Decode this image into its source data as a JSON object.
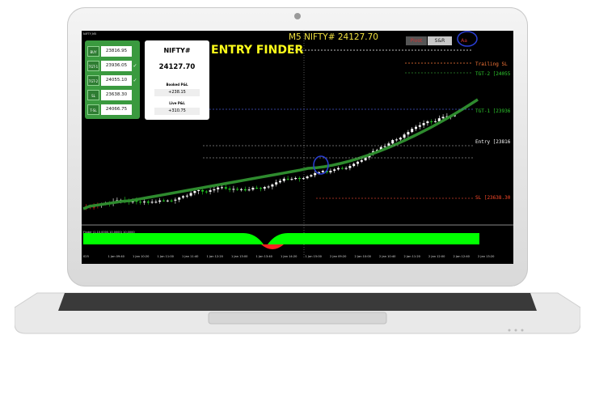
{
  "window": {
    "title": "M5 NIFTY# 24127.70",
    "corner_label": "NIFTY,M5"
  },
  "overlay_title": "ENTRY FINDER",
  "panel": {
    "rows": [
      {
        "key": "BUY",
        "value": "23816.95",
        "check": ""
      },
      {
        "key": "TGT-1",
        "value": "23936.05",
        "check": "✓"
      },
      {
        "key": "TGT-2",
        "value": "24055.10",
        "check": "✓"
      },
      {
        "key": "SL",
        "value": "23638.30",
        "check": ""
      },
      {
        "key": "T-SL",
        "value": "24066.75",
        "check": ""
      }
    ]
  },
  "info_box": {
    "symbol": "NIFTY#",
    "price": "24127.70",
    "booked_label": "Booked P&L",
    "booked_value": "+238.15",
    "live_label": "Live P&L",
    "live_value": "+310.75"
  },
  "buttons": {
    "pivot": "Pivot",
    "sr": "S&R",
    "third": "Aa"
  },
  "right_labels": {
    "trailing_sl": "Trailing SL",
    "tgt2": "TGT-2 [24055",
    "tgt1": "TGT-1 [23936",
    "entry": "Entry [23816",
    "sl": "SL [23638.30"
  },
  "indicator_label": "Finder (1,10,0000,10,0000) 10,0000",
  "x_ticks": [
    "025",
    "1 Jan 09:40",
    "1 Jan 10:20",
    "1 Jan 11:00",
    "1 Jan 11:40",
    "1 Jan 12:20",
    "1 Jan 13:00",
    "1 Jan 13:40",
    "1 Jan 14:20",
    "1 Jan 15:00",
    "2 Jan 09:20",
    "2 Jan 10:00",
    "2 Jan 10:40",
    "2 Jan 11:20",
    "2 Jan 12:00",
    "2 Jan 12:40",
    "2 Jan 13:20"
  ],
  "colors": {
    "bull": "#ffffff",
    "bear": "#22cc22",
    "ma": "#2e8b2e",
    "indicator_pos": "#00ff00",
    "indicator_neg": "#ff2020",
    "title": "#f0e040",
    "entry_finder": "#ffff1a"
  }
}
